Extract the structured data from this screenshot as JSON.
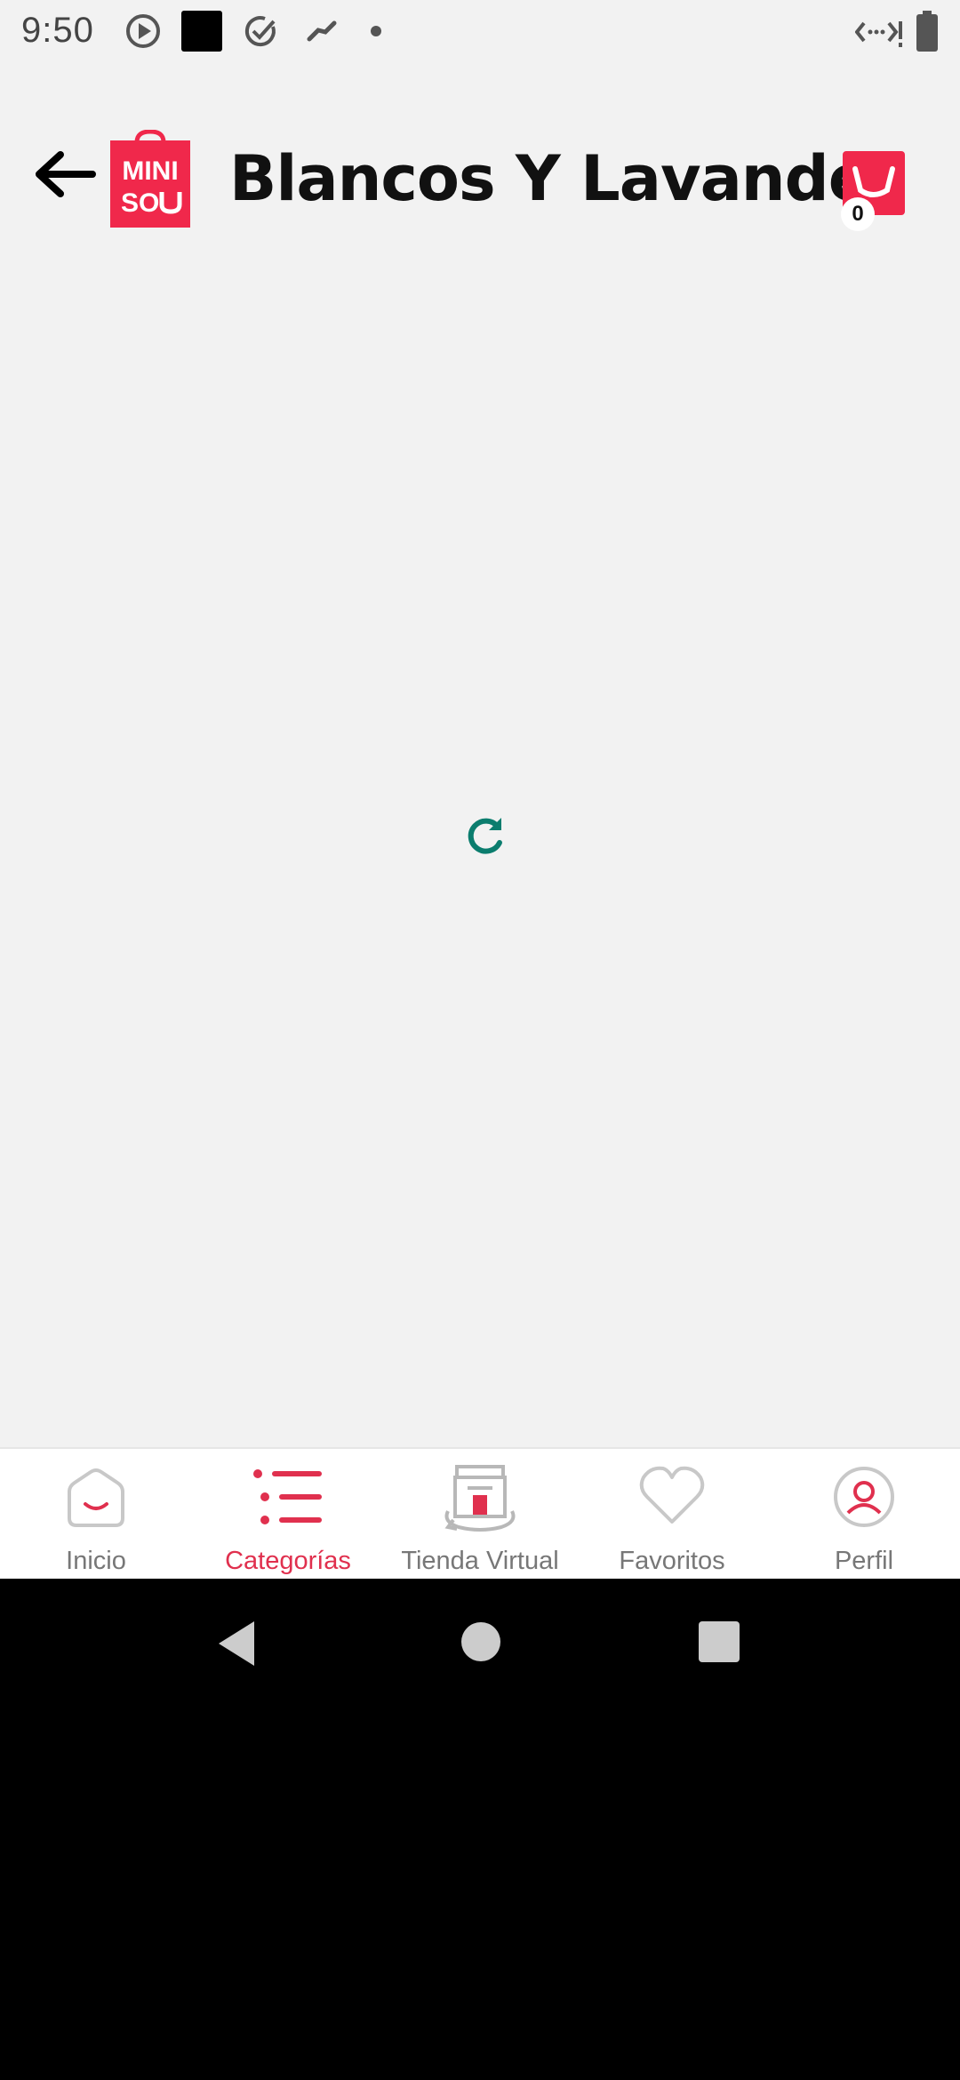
{
  "status_bar": {
    "time": "9:50"
  },
  "header": {
    "title": "Blancos Y Lavandería",
    "logo_text_line1": "MINI",
    "logo_text_line2": "SO",
    "cart_count": "0"
  },
  "colors": {
    "brand": "#f0284b",
    "accent_active": "#e0304e",
    "loader": "#0b7d6e",
    "background": "#f2f2f2"
  },
  "bottom_nav": {
    "items": [
      {
        "label": "Inicio",
        "icon": "home-icon",
        "active": false
      },
      {
        "label": "Categorías",
        "icon": "categories-list-icon",
        "active": true
      },
      {
        "label": "Tienda Virtual",
        "icon": "virtual-store-icon",
        "active": false
      },
      {
        "label": "Favoritos",
        "icon": "heart-icon",
        "active": false
      },
      {
        "label": "Perfil",
        "icon": "profile-icon",
        "active": false
      }
    ]
  }
}
